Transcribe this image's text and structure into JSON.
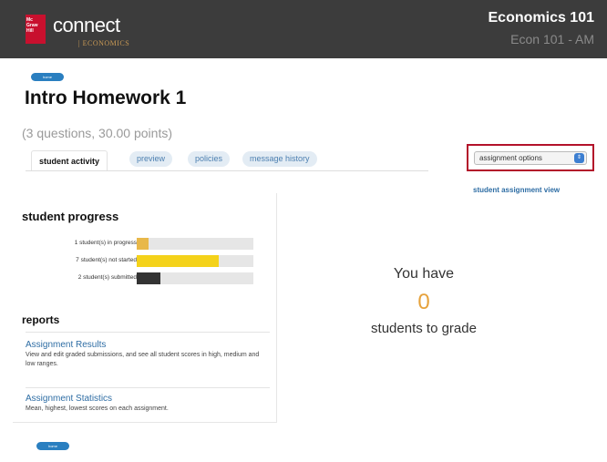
{
  "header": {
    "logo_text": "Mc\nGraw\nHill",
    "app_name": "connect",
    "app_sub": "| ECONOMICS",
    "course_title": "Economics 101",
    "course_section": "Econ 101 - AM"
  },
  "nav": {
    "home_label": "home"
  },
  "assignment": {
    "title": "Intro Homework 1",
    "meta": "(3 questions, 30.00 points)"
  },
  "tabs": [
    {
      "label": "student activity",
      "active": true
    },
    {
      "label": "preview",
      "active": false
    },
    {
      "label": "policies",
      "active": false
    },
    {
      "label": "message history",
      "active": false
    }
  ],
  "assignment_options": {
    "selected": "assignment options",
    "arrow_icon": "select-arrows-icon"
  },
  "student_view_link": "student assignment view",
  "progress": {
    "title": "student progress",
    "rows": [
      {
        "label": "1 student(s) in progress",
        "fraction": 0.1,
        "color": "#e8b84a"
      },
      {
        "label": "7 student(s) not started",
        "fraction": 0.7,
        "color": "#f4d21a"
      },
      {
        "label": "2 student(s) submitted",
        "fraction": 0.2,
        "color": "#333333"
      }
    ]
  },
  "reports": {
    "title": "reports",
    "items": [
      {
        "link": "Assignment Results",
        "desc": "View and edit graded submissions, and see all student scores in high, medium and low ranges."
      },
      {
        "link": "Assignment Statistics",
        "desc": "Mean, highest, lowest scores on each assignment."
      }
    ]
  },
  "grading": {
    "pre": "You have",
    "count": "0",
    "post": "students to grade"
  },
  "colors": {
    "accent": "#2e6da4",
    "header_bg": "#3c3c3c",
    "highlight_frame": "#b3122a",
    "count": "#e6a23c"
  }
}
